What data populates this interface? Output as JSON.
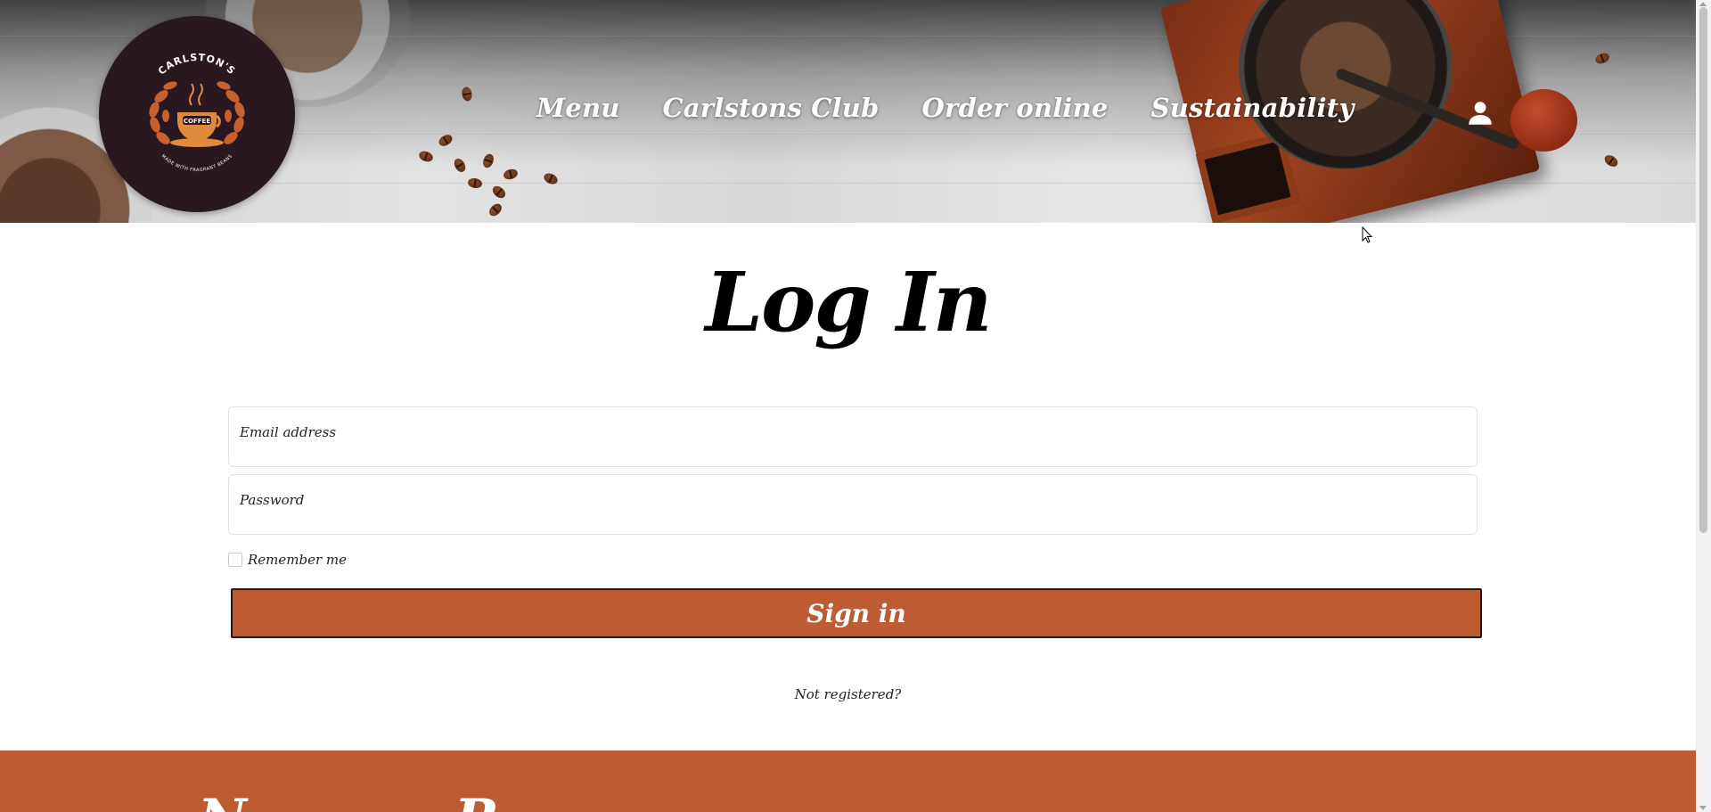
{
  "header": {
    "logo": {
      "brand": "CARLSTON'S",
      "badge": "COFFEE",
      "tagline": "MADE WITH FRAGRANT BEANS"
    },
    "nav": [
      {
        "label": "Menu"
      },
      {
        "label": "Carlstons Club"
      },
      {
        "label": "Order online"
      },
      {
        "label": "Sustainability"
      }
    ],
    "account_icon": "user-icon"
  },
  "login": {
    "title": "Log In",
    "email_label": "Email address",
    "password_label": "Password",
    "remember_label": "Remember me",
    "remember_checked": false,
    "submit_label": "Sign in",
    "register_link": "Not registered?"
  },
  "footer": {
    "partial_text_1": "N",
    "partial_text_2": "R"
  },
  "colors": {
    "accent": "#bd5b32",
    "logo_bg": "#2a1820",
    "text": "#222222"
  }
}
